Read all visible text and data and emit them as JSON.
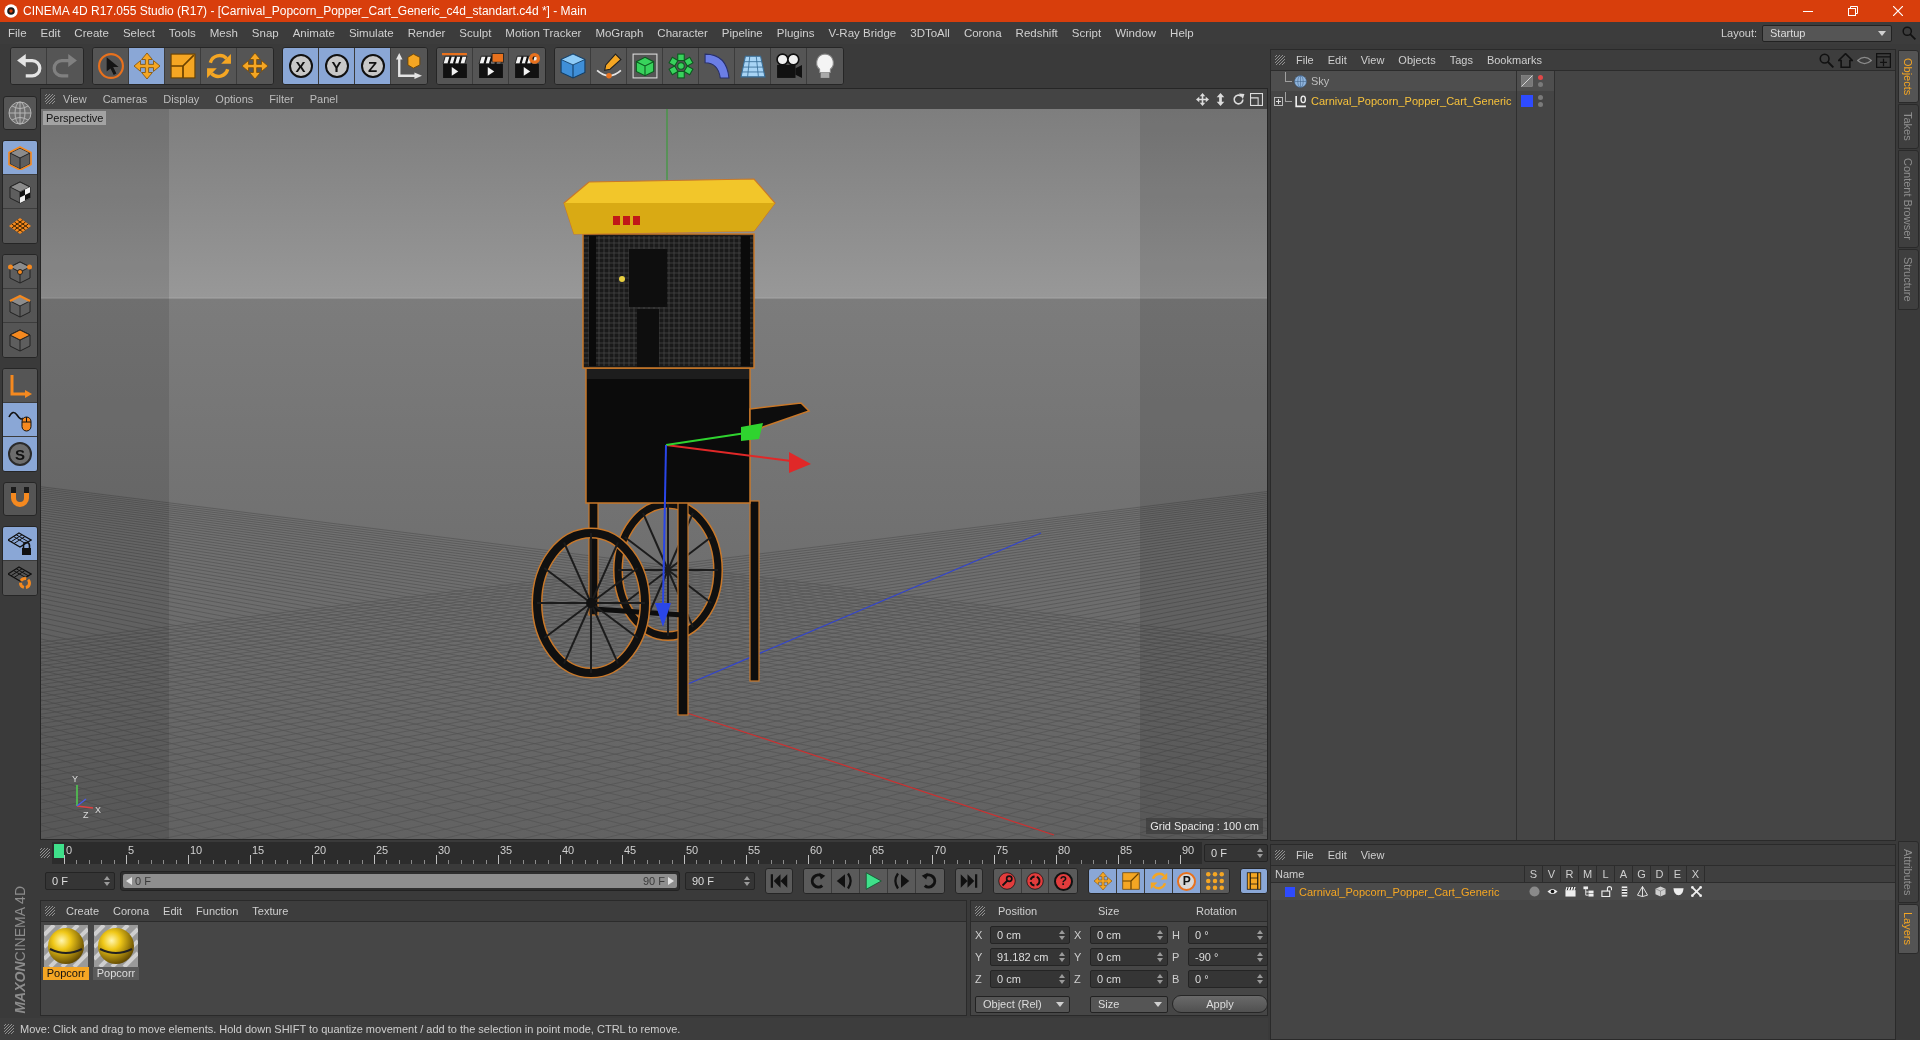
{
  "window": {
    "title": "CINEMA 4D R17.055 Studio (R17) - [Carnival_Popcorn_Popper_Cart_Generic_c4d_standart.c4d *] - Main"
  },
  "menu_bar": {
    "items": [
      "File",
      "Edit",
      "Create",
      "Select",
      "Tools",
      "Mesh",
      "Snap",
      "Animate",
      "Simulate",
      "Render",
      "Sculpt",
      "Motion Tracker",
      "MoGraph",
      "Character",
      "Pipeline",
      "Plugins",
      "V-Ray Bridge",
      "3DToAll",
      "Corona",
      "Redshift",
      "Script",
      "Window",
      "Help"
    ],
    "layout_label": "Layout:",
    "layout_value": "Startup"
  },
  "toolbar": {
    "history": [
      {
        "kind": "undo",
        "disabled": false
      },
      {
        "kind": "redo",
        "disabled": true
      }
    ],
    "tools": [
      {
        "kind": "select",
        "selected": false
      },
      {
        "kind": "move",
        "selected": true
      },
      {
        "kind": "scale",
        "selected": false
      },
      {
        "kind": "rotate",
        "selected": false
      },
      {
        "kind": "move",
        "selected": false
      }
    ],
    "axes": [
      {
        "kind": "axis-letter",
        "label": "X",
        "selected": true
      },
      {
        "kind": "axis-letter",
        "label": "Y",
        "selected": true
      },
      {
        "kind": "axis-letter",
        "label": "Z",
        "selected": true
      },
      {
        "kind": "coord-system",
        "selected": false
      }
    ],
    "render": [
      {
        "kind": "render-view"
      },
      {
        "kind": "picture-viewer"
      },
      {
        "kind": "render-settings"
      }
    ],
    "create": [
      {
        "kind": "cube"
      },
      {
        "kind": "pen"
      },
      {
        "kind": "subdivision"
      },
      {
        "kind": "cloner"
      },
      {
        "kind": "bend"
      },
      {
        "kind": "floor"
      },
      {
        "kind": "camera"
      },
      {
        "kind": "light"
      }
    ]
  },
  "left_tools": {
    "groups": [
      [
        {
          "kind": "make-editable",
          "selected": false
        }
      ],
      [
        {
          "kind": "model",
          "selected": true
        },
        {
          "kind": "texture",
          "selected": false
        },
        {
          "kind": "workplane",
          "selected": false
        }
      ],
      [
        {
          "kind": "points",
          "selected": false
        },
        {
          "kind": "edges",
          "selected": false
        },
        {
          "kind": "polygons",
          "selected": false
        }
      ],
      [
        {
          "kind": "axis",
          "selected": false
        },
        {
          "kind": "tweak",
          "selected": true
        },
        {
          "kind": "solo-letter",
          "label": "S",
          "selected": true
        }
      ],
      [
        {
          "kind": "magnet",
          "selected": false
        }
      ],
      [
        {
          "kind": "workplane-lock",
          "selected": true
        },
        {
          "kind": "grid-rotate",
          "selected": false
        }
      ]
    ]
  },
  "logo": {
    "lines": [
      "MAXON",
      "CINEMA 4D"
    ]
  },
  "viewport": {
    "menu": [
      "View",
      "Cameras",
      "Display",
      "Options",
      "Filter",
      "Panel"
    ],
    "camera": "Perspective",
    "grid_spacing": "Grid Spacing : 100 cm",
    "axis_labels": [
      "Y",
      "X",
      "Z"
    ]
  },
  "timeline": {
    "ruler_labels": [
      "0",
      "5",
      "10",
      "15",
      "20",
      "25",
      "30",
      "35",
      "40",
      "45",
      "50",
      "55",
      "60",
      "65",
      "70",
      "75",
      "80",
      "85",
      "90"
    ],
    "playhead": {
      "level": 0
    },
    "frame_field": "0 F"
  },
  "transport": {
    "start_field": "0 F",
    "range": {
      "start": "0 F",
      "end": "90 F",
      "level": 1
    },
    "end_field": "90 F",
    "groups": [
      [
        {
          "kind": "go-start"
        }
      ],
      [
        {
          "kind": "prev-key"
        },
        {
          "kind": "prev-frame"
        },
        {
          "kind": "play"
        },
        {
          "kind": "next-frame"
        },
        {
          "kind": "next-key"
        }
      ],
      [
        {
          "kind": "go-end"
        }
      ],
      [
        {
          "kind": "record"
        },
        {
          "kind": "autokey"
        },
        {
          "kind": "key-letter",
          "label": "?"
        }
      ],
      [
        {
          "kind": "move",
          "selected": true
        },
        {
          "kind": "scale",
          "selected": true
        },
        {
          "kind": "rotate",
          "selected": true
        },
        {
          "kind": "param-letter",
          "label": "P",
          "selected": true
        },
        {
          "kind": "point-level",
          "selected": false
        }
      ],
      [
        {
          "kind": "film",
          "selected": true
        }
      ]
    ]
  },
  "materials": {
    "menu": [
      "Create",
      "Corona",
      "Edit",
      "Function",
      "Texture"
    ],
    "items": [
      {
        "name": "Popcorr",
        "selected": true
      },
      {
        "name": "Popcorr",
        "selected": false
      }
    ]
  },
  "coordinates": {
    "headers": [
      "Position",
      "Size",
      "Rotation"
    ],
    "rows": [
      [
        {
          "axis": "X",
          "value": "0 cm"
        },
        {
          "axis": "X",
          "value": "0 cm"
        },
        {
          "axis": "H",
          "value": "0 °"
        }
      ],
      [
        {
          "axis": "Y",
          "value": "91.182 cm"
        },
        {
          "axis": "Y",
          "value": "0 cm"
        },
        {
          "axis": "P",
          "value": "-90 °"
        }
      ],
      [
        {
          "axis": "Z",
          "value": "0 cm"
        },
        {
          "axis": "Z",
          "value": "0 cm"
        },
        {
          "axis": "B",
          "value": "0 °"
        }
      ]
    ],
    "mode": "Object (Rel)",
    "size_mode": "Size",
    "apply": "Apply"
  },
  "status_bar": "Move: Click and drag to move elements. Hold down SHIFT to quantize movement / add to the selection in point mode, CTRL to remove.",
  "object_manager": {
    "menu": [
      "File",
      "Edit",
      "View",
      "Objects",
      "Tags",
      "Bookmarks"
    ],
    "objects": [
      {
        "name": "Sky",
        "kind": "sky",
        "selected": false,
        "tags": [
          {
            "kind": "display"
          }
        ],
        "dots": [
          {
            "color": "#e04848"
          },
          {
            "color": "#7a7a7a"
          }
        ]
      },
      {
        "name": "Carnival_Popcorn_Popper_Cart_Generic",
        "kind": "null",
        "expanded": false,
        "selected": true,
        "color": "#2e4bff",
        "dots": [
          {
            "color": "#7a7a7a"
          },
          {
            "color": "#7a7a7a"
          }
        ]
      }
    ]
  },
  "layer_manager": {
    "menu": [
      "File",
      "Edit",
      "View"
    ],
    "columns": [
      "Name",
      "S",
      "V",
      "R",
      "M",
      "L",
      "A",
      "G",
      "D",
      "E",
      "X"
    ],
    "layers": [
      {
        "name": "Carnival_Popcorn_Popper_Cart_Generic",
        "color": "#2e4bff",
        "selected": true,
        "switches": [
          {
            "kind": "solo"
          },
          {
            "kind": "view"
          },
          {
            "kind": "render"
          },
          {
            "kind": "manager"
          },
          {
            "kind": "lock"
          },
          {
            "kind": "animation"
          },
          {
            "kind": "generators"
          },
          {
            "kind": "deformers"
          },
          {
            "kind": "expressions"
          },
          {
            "kind": "xref"
          }
        ]
      }
    ]
  },
  "side_tabs": {
    "top": [
      {
        "label": "Objects",
        "selected": true
      },
      {
        "label": "Takes",
        "selected": false
      },
      {
        "label": "Content Browser",
        "selected": false
      },
      {
        "label": "Structure",
        "selected": false
      }
    ],
    "bottom": [
      {
        "label": "Attributes",
        "selected": false
      },
      {
        "label": "Layers",
        "selected": true
      }
    ]
  }
}
